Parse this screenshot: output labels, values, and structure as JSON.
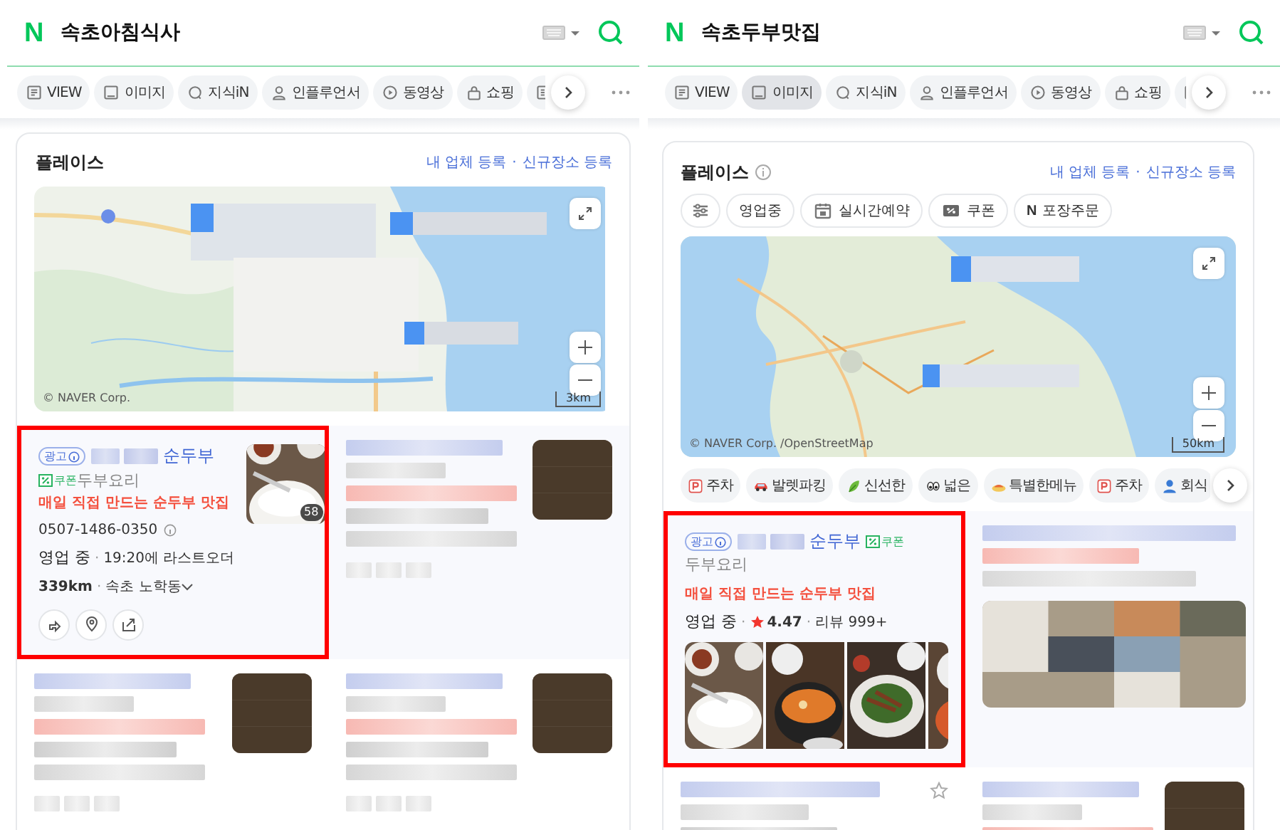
{
  "panels": [
    {
      "logo": "N",
      "query": "속초아침식사",
      "tabs": [
        {
          "label": "VIEW",
          "selected": false
        },
        {
          "label": "이미지",
          "selected": false
        },
        {
          "label": "지식iN",
          "selected": false
        },
        {
          "label": "인플루언서",
          "selected": false
        },
        {
          "label": "동영상",
          "selected": false
        },
        {
          "label": "쇼핑",
          "selected": false
        },
        {
          "kind": "partial",
          "selected": false
        }
      ],
      "place": {
        "title": "플레이스",
        "links": [
          "내 업체 등록",
          "신규장소 등록"
        ],
        "link_separator": "·",
        "map": {
          "kind": "coast",
          "credit": "© NAVER Corp.",
          "scale": "3km"
        },
        "listings": [
          {
            "kind": "ad_thumb",
            "highlighted": true,
            "ad_label": "광고",
            "name": "순두부",
            "coupon": "쿠폰",
            "category": "두부요리",
            "promo": "매일 직접 만드는 순두부 맛집",
            "phone": "0507-1486-0350",
            "status": "영업 중",
            "separator": "·",
            "detail": "19:20에 라스트오더",
            "distance": "339km",
            "area": "속초 노학동",
            "photo_count": "58"
          },
          {
            "kind": "blurred",
            "highlighted": false
          },
          {
            "kind": "blurred",
            "highlighted": false
          },
          {
            "kind": "blurred",
            "highlighted": false
          }
        ]
      }
    },
    {
      "logo": "N",
      "query": "속초두부맛집",
      "tabs": [
        {
          "label": "VIEW",
          "selected": false
        },
        {
          "label": "이미지",
          "selected": true
        },
        {
          "label": "지식iN",
          "selected": false
        },
        {
          "label": "인플루언서",
          "selected": false
        },
        {
          "label": "동영상",
          "selected": false
        },
        {
          "label": "쇼핑",
          "selected": false
        },
        {
          "kind": "partial",
          "selected": false
        }
      ],
      "place": {
        "title": "플레이스",
        "info_icon": true,
        "links": [
          "내 업체 등록",
          "신규장소 등록"
        ],
        "link_separator": "·",
        "filters": [
          {
            "kind": "icon"
          },
          {
            "label": "영업중"
          },
          {
            "label": "실시간예약"
          },
          {
            "label": "쿠폰"
          },
          {
            "label": "포장주문",
            "mark": "N"
          }
        ],
        "map": {
          "kind": "peninsula",
          "credit": "© NAVER Corp. /OpenStreetMap",
          "scale": "50km"
        },
        "keywords": [
          {
            "label": "주차"
          },
          {
            "label": "발렛파킹"
          },
          {
            "label": "신선한"
          },
          {
            "label": "넓은"
          },
          {
            "label": "특별한메뉴"
          },
          {
            "label": "주차"
          },
          {
            "label": "회식"
          }
        ],
        "listings": [
          {
            "kind": "ad_gallery",
            "highlighted": true,
            "ad_label": "광고",
            "name": "순두부",
            "coupon": "쿠폰",
            "category": "두부요리",
            "promo": "매일 직접 만드는 순두부 맛집",
            "status": "영업 중",
            "separator": "·",
            "rating": "4.47",
            "reviews": "리뷰 999+"
          },
          {
            "kind": "blurred_gallery",
            "highlighted": false
          },
          {
            "kind": "blurred_star",
            "highlighted": false
          },
          {
            "kind": "blurred",
            "highlighted": false
          }
        ]
      }
    }
  ]
}
